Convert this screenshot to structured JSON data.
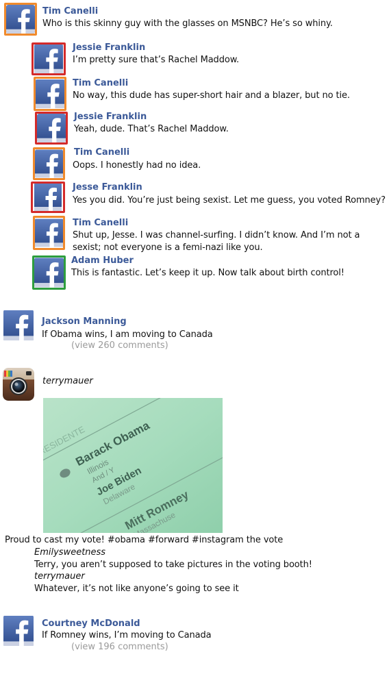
{
  "thread": [
    {
      "name": "Tim Canelli",
      "text": "Who is this skinny guy with the glasses on MSNBC? He’s so whiny.",
      "border": "#f08a2c"
    },
    {
      "name": "Jessie Franklin",
      "text": "I’m pretty sure that’s Rachel Maddow.",
      "border": "#d42a2a"
    },
    {
      "name": "Tim Canelli",
      "text": "No way, this dude has super-short hair and a blazer, but no tie.",
      "border": "#f08a2c"
    },
    {
      "name": "Jessie Franklin",
      "text": "Yeah, dude. That’s Rachel Maddow.",
      "border": "#d42a2a"
    },
    {
      "name": "Tim Canelli",
      "text": "Oops. I honestly had no idea.",
      "border": "#f08a2c"
    },
    {
      "name": "Jesse Franklin",
      "text": "Yes you did. You’re just being sexist. Let me guess, you voted Romney?",
      "border": "#d42a2a"
    },
    {
      "name": "Tim Canelli",
      "text": "Shut up, Jesse. I was channel-surfing. I didn’t know. And I’m not a sexist; not everyone is a femi-nazi like you.",
      "border": "#f08a2c"
    },
    {
      "name": "Adam Huber",
      "text": "This is fantastic. Let’s keep it up. Now talk about birth control!",
      "border": "#2e9e3e"
    }
  ],
  "post_jackson": {
    "name": "Jackson Manning",
    "text": "If Obama wins, I am moving to Canada",
    "comments_link": "(view 260 comments)"
  },
  "instagram_post": {
    "username": "terrymauer",
    "photo_text": {
      "line1": "PRESIDENTE",
      "line2": "Barack Obama",
      "line3": "Illinois",
      "line4": "And / Y",
      "line5": "Joe Biden",
      "line6": "Delaware",
      "line7": "Mitt Romney",
      "line8": "Massachuse"
    },
    "caption": "Proud to cast my vote! #obama #forward #instagram the vote",
    "comments": [
      {
        "user": "Emilysweetness",
        "text": "Terry, you aren’t supposed to take pictures in the voting booth!"
      },
      {
        "user": "terrymauer",
        "text": "Whatever, it’s not like anyone’s going to see it"
      }
    ]
  },
  "post_courtney": {
    "name": "Courtney McDonald",
    "text": "If Romney wins, I’m moving to Canada",
    "comments_link": "(view 196 comments)"
  },
  "colors": {
    "facebook_blue": "#3b5998",
    "orange_frame": "#f08a2c",
    "red_frame": "#d42a2a",
    "green_frame": "#2e9e3e"
  }
}
